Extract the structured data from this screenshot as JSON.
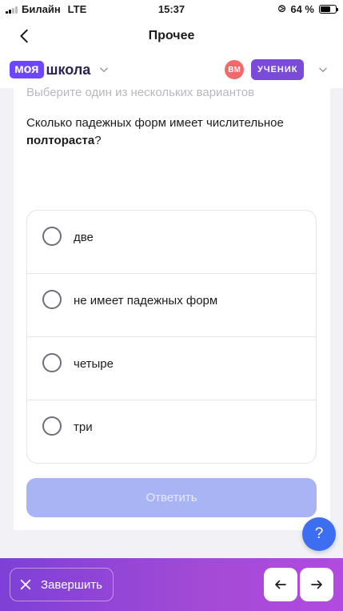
{
  "status_bar": {
    "carrier": "Билайн",
    "network": "LTE",
    "time": "15:37",
    "battery_percent": "64 %",
    "battery_level": 0.64
  },
  "nav": {
    "title": "Прочее",
    "back_icon": "chevron-left-icon"
  },
  "app_header": {
    "logo_badge": "моя",
    "logo_text": "школа",
    "avatar_initials": "ВМ",
    "role": "УЧЕНИК",
    "colors": {
      "brand": "#6c47ff",
      "avatar": "#f06a6a",
      "role_badge": "#7a4ad9"
    }
  },
  "question": {
    "hint": "Выберите один из нескольких вариантов",
    "text_before": "Сколько падежных форм имеет числительное ",
    "text_bold": "полтораста",
    "text_after": "?"
  },
  "options": [
    {
      "label": "две"
    },
    {
      "label": "не имеет падежных форм"
    },
    {
      "label": "четыре"
    },
    {
      "label": "три"
    }
  ],
  "submit_label": "Ответить",
  "help_label": "?",
  "bottom_bar": {
    "finish_label": "Завершить",
    "prev_icon": "arrow-left-icon",
    "next_icon": "arrow-right-icon"
  }
}
